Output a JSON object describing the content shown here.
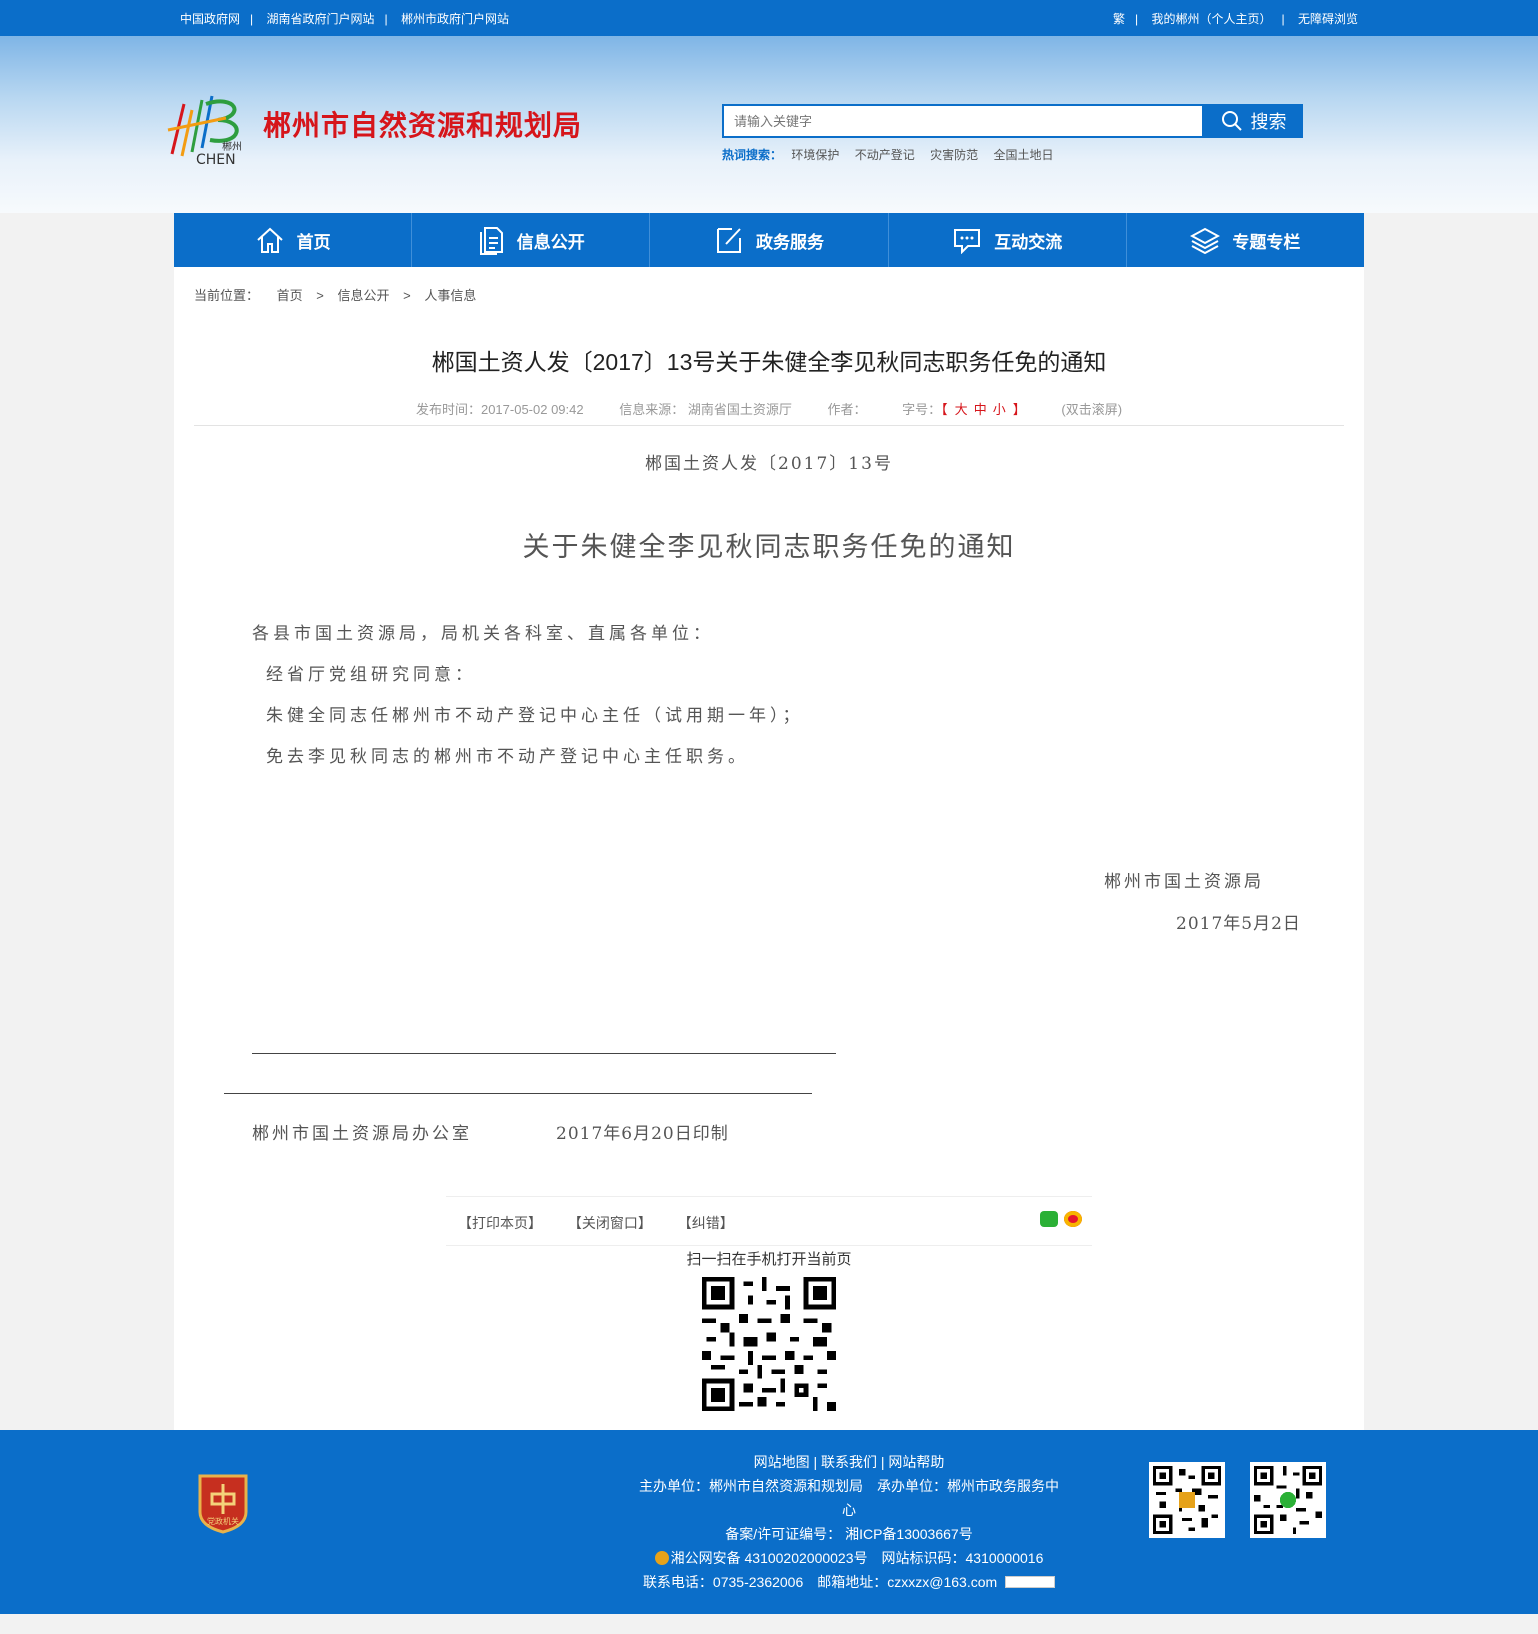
{
  "topbar": {
    "left_links": [
      "中国政府网",
      "湖南省政府门户网站",
      "郴州市政府门户网站"
    ],
    "right_links": [
      "繁",
      "我的郴州（个人主页）",
      "无障碍浏览"
    ]
  },
  "header": {
    "logo_text": "郴州",
    "logo_sub": "CHEN",
    "site_title": "郴州市自然资源和规划局",
    "search_placeholder": "请输入关键字",
    "search_button": "搜索",
    "hot_label": "热词搜索：",
    "hot_words": [
      "环境保护",
      "不动产登记",
      "灾害防范",
      "全国土地日"
    ]
  },
  "nav": {
    "items": [
      {
        "label": "首页",
        "icon": "home-icon"
      },
      {
        "label": "信息公开",
        "icon": "document-icon"
      },
      {
        "label": "政务服务",
        "icon": "edit-icon"
      },
      {
        "label": "互动交流",
        "icon": "chat-icon"
      },
      {
        "label": "专题专栏",
        "icon": "layers-icon"
      }
    ]
  },
  "breadcrumb": {
    "label": "当前位置：",
    "items": [
      "首页",
      "信息公开",
      "人事信息"
    ],
    "separator": ">"
  },
  "article": {
    "title": "郴国土资人发〔2017〕13号关于朱健全李见秋同志职务任免的通知",
    "meta": {
      "publish_time": "发布时间：2017-05-02 09:42",
      "source": "信息来源： 湖南省国土资源厅",
      "author": "作者：",
      "font_size_label": "字号：",
      "font_size_open": "【",
      "font_size_large": "大",
      "font_size_medium": "中",
      "font_size_small": "小",
      "font_size_close": "】",
      "scroll": "(双击滚屏)"
    },
    "doc_number": "郴国土资人发〔2017〕13号",
    "doc_title": "关于朱健全李见秋同志职务任免的通知",
    "paragraphs": [
      "各县市国土资源局，局机关各科室、直属各单位：",
      "经省厅党组研究同意：",
      "朱健全同志任郴州市不动产登记中心主任（试用期一年）；",
      "免去李见秋同志的郴州市不动产登记中心主任职务。"
    ],
    "signature_org": "郴州市国土资源局",
    "signature_date": "2017年5月2日",
    "print_org": "郴州市国土资源局办公室",
    "print_date": "2017年6月20日印制"
  },
  "tools": {
    "print": "【打印本页】",
    "close": "【关闭窗口】",
    "correct": "【纠错】",
    "share_icons": [
      "wechat-icon",
      "weibo-icon"
    ],
    "qr_caption": "扫一扫在手机打开当前页"
  },
  "footer": {
    "badge_text": "党政机关",
    "links": [
      "网站地图",
      "联系我们",
      "网站帮助"
    ],
    "host": "主办单位：郴州市自然资源和规划局　承办单位：郴州市政务服务中心",
    "icp": "备案/许可证编号： 湘ICP备13003667号",
    "police": "湘公网安备 43100202000023号　网站标识码：4310000016",
    "contact": "联系电话：0735-2362006　邮箱地址：czxxzx@163.com"
  },
  "colors": {
    "primary_blue": "#0b6ec9",
    "title_red": "#d6151b"
  }
}
